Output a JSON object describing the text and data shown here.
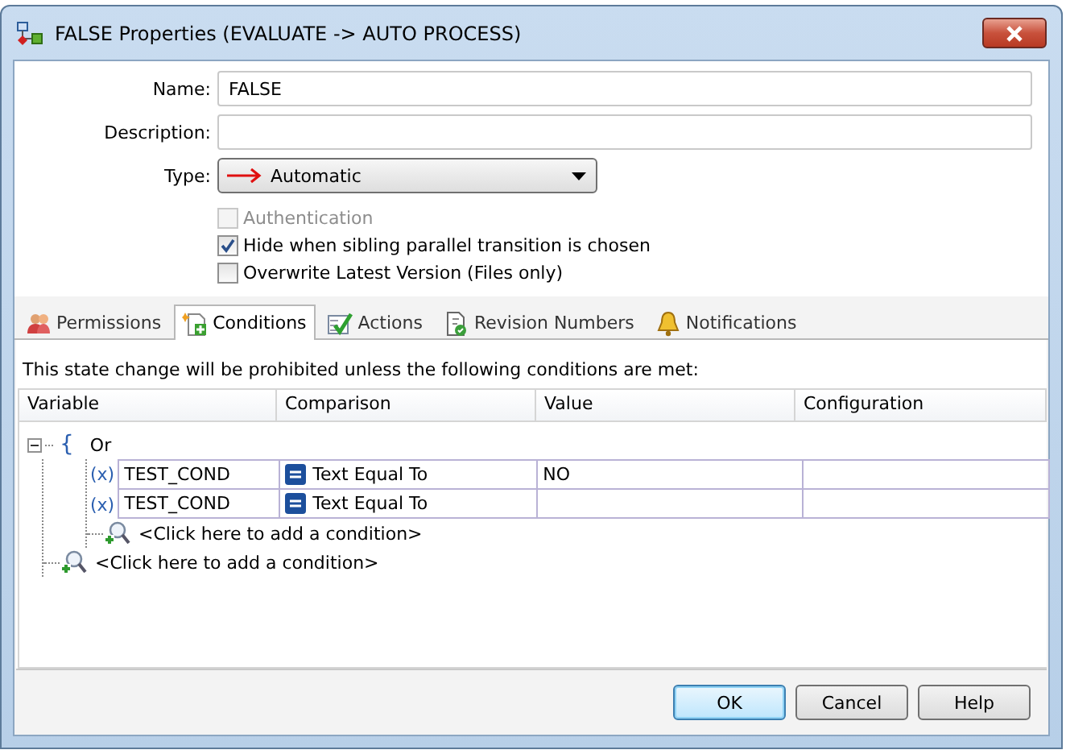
{
  "window": {
    "title": "FALSE Properties (EVALUATE -> AUTO PROCESS)"
  },
  "form": {
    "fields": [
      {
        "label": "Name:",
        "kind": "text",
        "value": "FALSE"
      },
      {
        "label": "Description:",
        "kind": "text"
      },
      {
        "label": "Type:",
        "kind": "dropdown",
        "value": "Automatic"
      }
    ],
    "checkboxes": [
      {
        "label": "Authentication",
        "checked": false,
        "disabled": true
      },
      {
        "label": "Hide when sibling parallel transition is chosen",
        "checked": true,
        "disabled": false
      },
      {
        "label": "Overwrite Latest Version (Files only)",
        "checked": false,
        "disabled": false
      }
    ]
  },
  "tabs": [
    {
      "label": "Permissions",
      "kind": "people",
      "selected": false
    },
    {
      "label": "Conditions",
      "kind": "conditions",
      "selected": true
    },
    {
      "label": "Actions",
      "kind": "actions",
      "selected": false
    },
    {
      "label": "Revision Numbers",
      "kind": "revision",
      "selected": false
    },
    {
      "label": "Notifications",
      "kind": "bell",
      "selected": false
    }
  ],
  "instruction": "This state change will be prohibited unless the following conditions are met:",
  "table": {
    "columns": [
      "Variable",
      "Comparison",
      "Value",
      "Configuration"
    ]
  },
  "tree": {
    "brace": "{",
    "operator": "Or",
    "expanded": true,
    "conditions": [
      {
        "marker": "(x)",
        "variable": "TEST_COND",
        "comparison": "Text Equal To",
        "value": "NO"
      },
      {
        "marker": "(x)",
        "variable": "TEST_COND",
        "comparison": "Text Equal To"
      }
    ],
    "add_inner": "<Click here to add a condition>",
    "add_outer": "<Click here to add a condition>"
  },
  "buttons": [
    {
      "label": "OK",
      "default": true
    },
    {
      "label": "Cancel",
      "default": false
    },
    {
      "label": "Help",
      "default": false
    }
  ]
}
